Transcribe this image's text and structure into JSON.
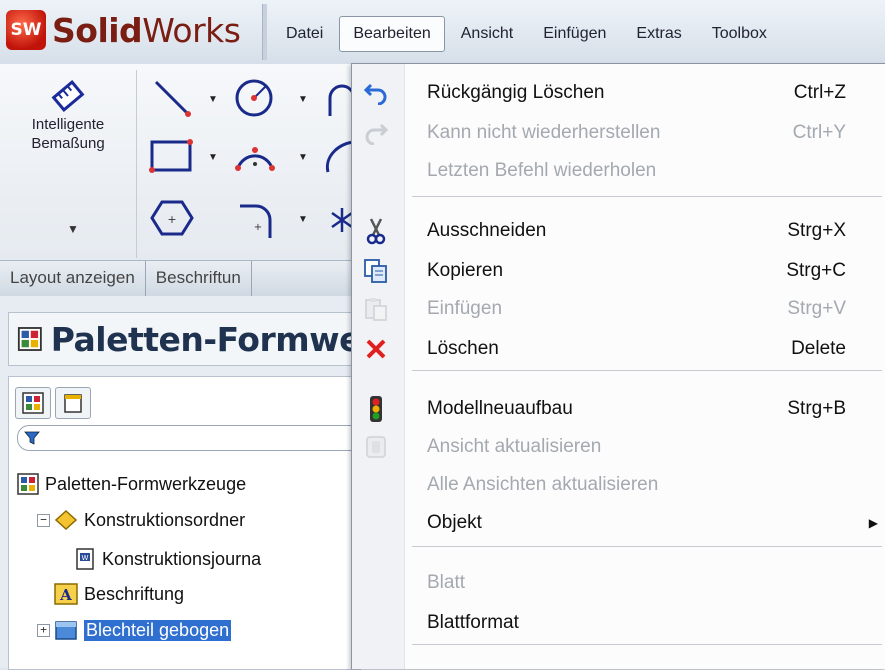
{
  "app": {
    "logo_mark": "SW",
    "logo_bold": "Solid",
    "logo_rest": "Works"
  },
  "menubar": {
    "items": [
      {
        "label": "Datei"
      },
      {
        "label": "Bearbeiten",
        "active": true
      },
      {
        "label": "Ansicht"
      },
      {
        "label": "Einfügen"
      },
      {
        "label": "Extras"
      },
      {
        "label": "Toolbox"
      }
    ]
  },
  "ribbon": {
    "smart_dimension": {
      "line1": "Intelligente",
      "line2": "Bemaßung",
      "icon": "smart-dimension-icon"
    },
    "tools": [
      "line-icon",
      "circle-icon",
      "arc-icon",
      "rectangle-icon",
      "centerpoint-arc-icon",
      "spline-icon",
      "polygon-icon",
      "sketch-fillet-icon",
      "trim-icon"
    ]
  },
  "command_tabs": [
    {
      "label": "Layout anzeigen"
    },
    {
      "label": "Beschriftun"
    }
  ],
  "panel": {
    "title": "Paletten-Formwe",
    "tree": [
      {
        "label": "Paletten-Formwerkzeuge",
        "icon": "drawing-icon",
        "level": 0,
        "expander": ""
      },
      {
        "label": "Konstruktionsordner",
        "icon": "design-binder-icon",
        "level": 1,
        "expander": "−"
      },
      {
        "label": "Konstruktionsjourna",
        "icon": "journal-icon",
        "level": 2,
        "expander": ""
      },
      {
        "label": "Beschriftung",
        "icon": "annotations-icon",
        "level": 1,
        "expander": ""
      },
      {
        "label": "Blechteil gebogen",
        "icon": "sheet-icon",
        "level": 1,
        "expander": "+",
        "selected": true
      }
    ]
  },
  "edit_menu": {
    "items": [
      {
        "label": "Rückgängig Löschen",
        "shortcut": "Ctrl+Z",
        "icon": "undo-icon",
        "enabled": true
      },
      {
        "label": "Kann nicht wiederherstellen",
        "shortcut": "Ctrl+Y",
        "icon": "redo-icon",
        "enabled": false
      },
      {
        "label": "Letzten Befehl wiederholen",
        "shortcut": "",
        "icon": "",
        "enabled": false
      },
      {
        "separator": true
      },
      {
        "label": "Ausschneiden",
        "shortcut": "Strg+X",
        "icon": "scissors-icon",
        "enabled": true
      },
      {
        "label": "Kopieren",
        "shortcut": "Strg+C",
        "icon": "copy-icon",
        "enabled": true
      },
      {
        "label": "Einfügen",
        "shortcut": "Strg+V",
        "icon": "paste-icon",
        "enabled": false
      },
      {
        "label": "Löschen",
        "shortcut": "Delete",
        "icon": "delete-icon",
        "enabled": true
      },
      {
        "separator": true
      },
      {
        "label": "Modellneuaufbau",
        "shortcut": "Strg+B",
        "icon": "traffic-light-icon",
        "enabled": true
      },
      {
        "label": "Ansicht aktualisieren",
        "shortcut": "",
        "icon": "refresh-view-icon",
        "enabled": false
      },
      {
        "label": "Alle Ansichten aktualisieren",
        "shortcut": "",
        "icon": "",
        "enabled": false
      },
      {
        "label": "Objekt",
        "shortcut": "",
        "icon": "",
        "enabled": true,
        "submenu": true
      },
      {
        "separator": true
      },
      {
        "label": "Blatt",
        "shortcut": "",
        "icon": "",
        "enabled": false
      },
      {
        "label": "Blattformat",
        "shortcut": "",
        "icon": "",
        "enabled": true
      },
      {
        "separator": true
      }
    ]
  }
}
